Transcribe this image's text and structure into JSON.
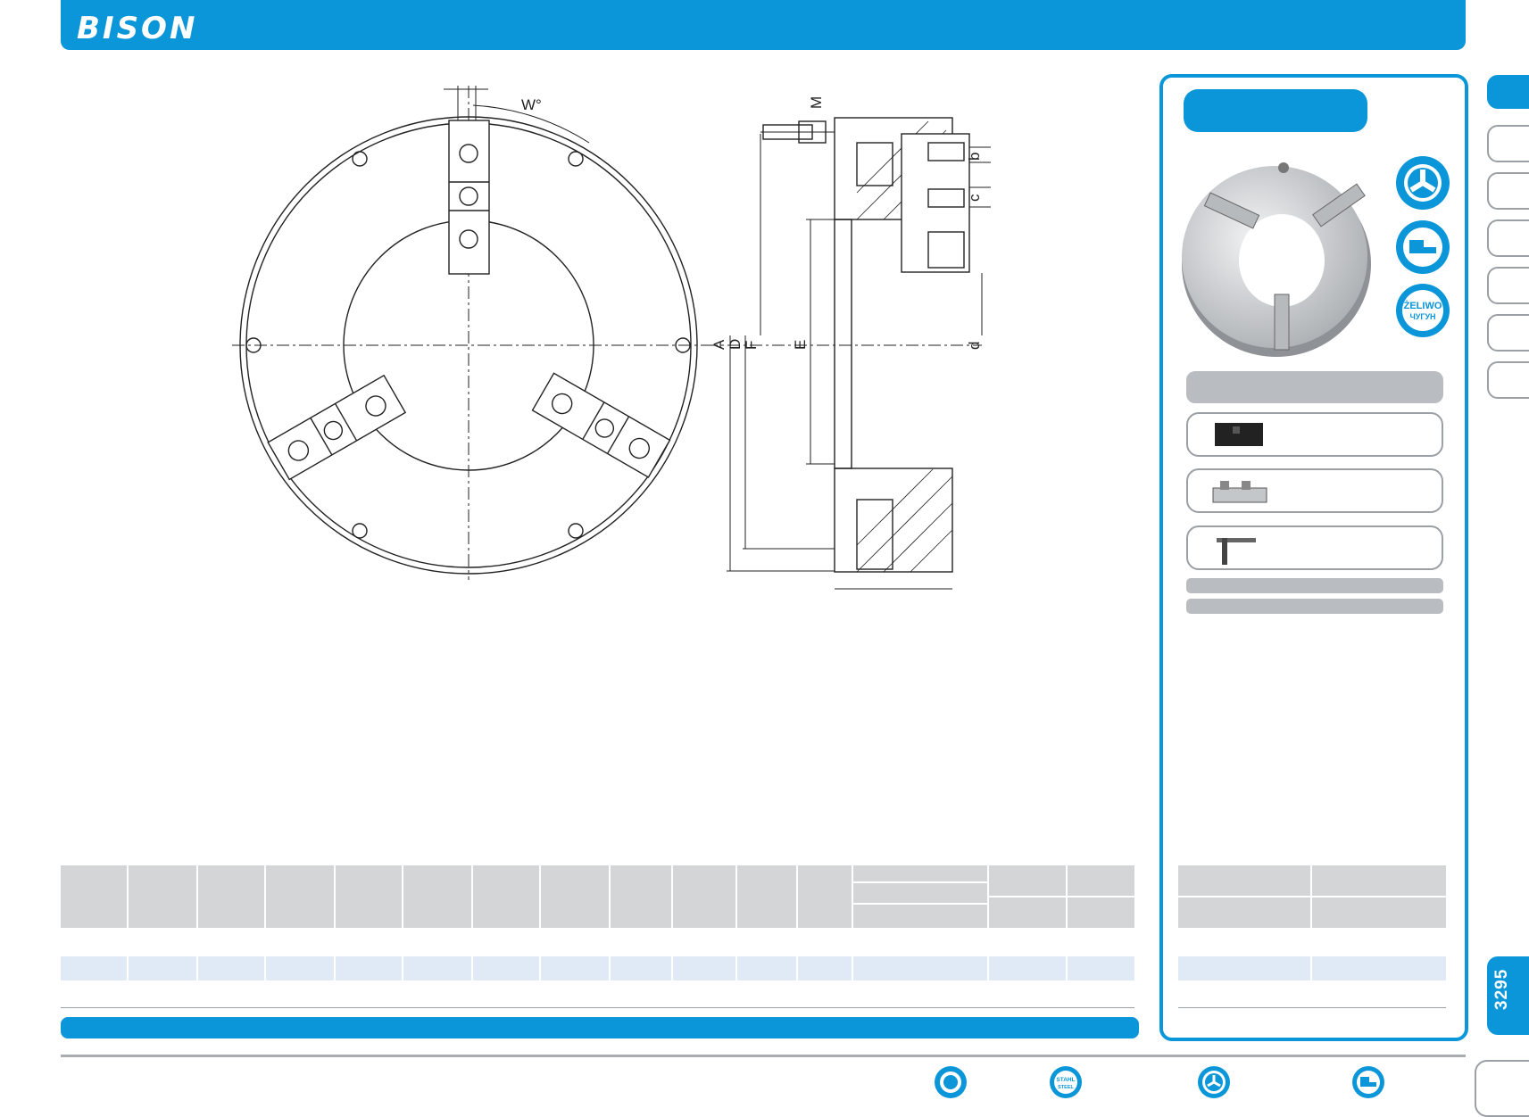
{
  "header": {
    "brand": "BISON"
  },
  "sidebar": {
    "page_number": "3295"
  },
  "drawing": {
    "front_view": {
      "angle_label": "W°"
    },
    "side_view": {
      "dimension_labels": {
        "A": "A",
        "D": "D",
        "F": "F",
        "E": "E",
        "M": "M",
        "b": "b",
        "c": "c",
        "d": "d"
      }
    }
  },
  "panel": {
    "badges": [
      {
        "name": "scroll-chuck-badge",
        "icon": "three-jaw-icon"
      },
      {
        "name": "jaw-type-badge",
        "icon": "stepped-jaw-icon"
      },
      {
        "name": "material-badge",
        "text_top": "ŻELIWO",
        "text_bottom": "ЧУГУН"
      }
    ],
    "accessories": [
      {
        "icon": "soft-jaw-icon"
      },
      {
        "icon": "top-jaw-icon"
      },
      {
        "icon": "t-key-icon"
      }
    ]
  },
  "footer": {
    "icons": [
      {
        "name": "gear-badge-icon"
      },
      {
        "name": "stahl-steel-badge-icon",
        "text_top": "STAHL",
        "text_bottom": "STEEL"
      },
      {
        "name": "chuck-badge-icon"
      },
      {
        "name": "jaw-badge-icon"
      }
    ]
  },
  "colors": {
    "brand_blue": "#0a96d8",
    "table_header": "#d3d5d7",
    "table_row": "#dfeaf6",
    "tab_border": "#9aa0a6"
  }
}
